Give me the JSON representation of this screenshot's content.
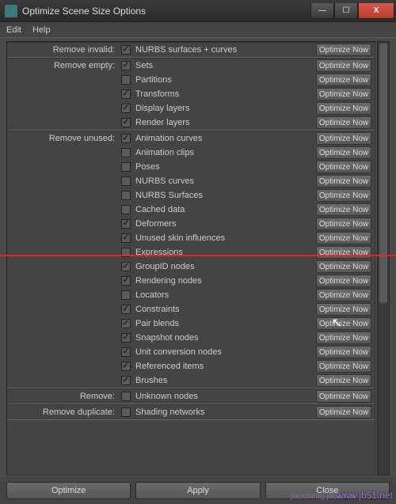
{
  "window": {
    "title": "Optimize Scene Size Options",
    "min": "—",
    "max": "☐",
    "close": "X"
  },
  "menu": {
    "edit": "Edit",
    "help": "Help"
  },
  "groups": [
    {
      "label": "Remove invalid:",
      "rows": [
        {
          "checked": true,
          "name": "NURBS surfaces + curves",
          "btn": "Optimize Now"
        }
      ]
    },
    {
      "label": "Remove empty:",
      "rows": [
        {
          "checked": true,
          "name": "Sets",
          "btn": "Optimize Now"
        },
        {
          "checked": false,
          "name": "Partitions",
          "btn": "Optimize Now"
        },
        {
          "checked": true,
          "name": "Transforms",
          "btn": "Optimize Now"
        },
        {
          "checked": true,
          "name": "Display layers",
          "btn": "Optimize Now"
        },
        {
          "checked": true,
          "name": "Render layers",
          "btn": "Optimize Now"
        }
      ]
    },
    {
      "label": "Remove unused:",
      "rows": [
        {
          "checked": true,
          "name": "Animation curves",
          "btn": "Optimize Now"
        },
        {
          "checked": false,
          "name": "Animation clips",
          "btn": "Optimize Now"
        },
        {
          "checked": false,
          "name": "Poses",
          "btn": "Optimize Now"
        },
        {
          "checked": false,
          "name": "NURBS curves",
          "btn": "Optimize Now"
        },
        {
          "checked": false,
          "name": "NURBS Surfaces",
          "btn": "Optimize Now"
        },
        {
          "checked": false,
          "name": "Cached data",
          "btn": "Optimize Now"
        },
        {
          "checked": true,
          "name": "Deformers",
          "btn": "Optimize Now"
        },
        {
          "checked": true,
          "name": "Unused skin influences",
          "btn": "Optimize Now"
        },
        {
          "checked": false,
          "name": "Expressions",
          "btn": "Optimize Now"
        },
        {
          "checked": true,
          "name": "GroupID nodes",
          "btn": "Optimize Now"
        },
        {
          "checked": true,
          "name": "Rendering nodes",
          "btn": "Optimize Now"
        },
        {
          "checked": false,
          "name": "Locators",
          "btn": "Optimize Now"
        },
        {
          "checked": true,
          "name": "Constraints",
          "btn": "Optimize Now"
        },
        {
          "checked": true,
          "name": "Pair blends",
          "btn": "Optimize Now"
        },
        {
          "checked": true,
          "name": "Snapshot nodes",
          "btn": "Optimize Now"
        },
        {
          "checked": true,
          "name": "Unit conversion nodes",
          "btn": "Optimize Now"
        },
        {
          "checked": true,
          "name": "Referenced items",
          "btn": "Optimize Now"
        },
        {
          "checked": true,
          "name": "Brushes",
          "btn": "Optimize Now"
        }
      ]
    },
    {
      "label": "Remove:",
      "rows": [
        {
          "checked": false,
          "name": "Unknown nodes",
          "btn": "Optimize Now"
        }
      ]
    },
    {
      "label": "Remove duplicate:",
      "rows": [
        {
          "checked": false,
          "name": "Shading networks",
          "btn": "Optimize Now"
        }
      ]
    }
  ],
  "footer": {
    "optimize": "Optimize",
    "apply": "Apply",
    "close": "Close"
  },
  "watermark": {
    "a": "www.jb51.net",
    "b": "jiaocheng.jb51.net"
  }
}
